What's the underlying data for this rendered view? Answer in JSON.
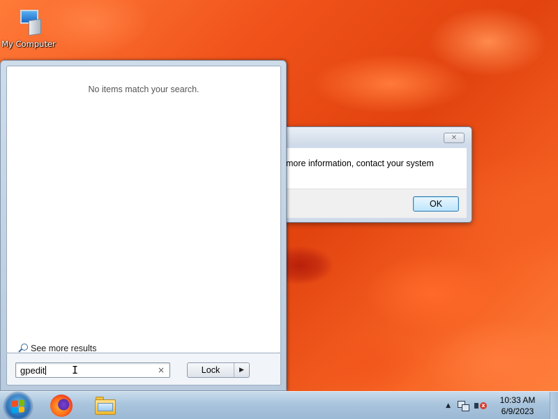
{
  "desktop": {
    "icons": [
      {
        "label": "My Computer",
        "icon": "computer-icon"
      }
    ]
  },
  "dialog": {
    "message": "more information, contact your system",
    "ok_label": "OK",
    "close_glyph": "✕"
  },
  "start_menu": {
    "no_results_text": "No items match your search.",
    "see_more_label": "See more results",
    "search": {
      "value": "gpedit",
      "clear_glyph": "×"
    },
    "power_button": {
      "label": "Lock",
      "arrow_glyph": "▶"
    }
  },
  "taskbar": {
    "apps": [
      {
        "name": "Firefox",
        "icon": "firefox-icon"
      },
      {
        "name": "Windows Explorer",
        "icon": "folder-icon"
      }
    ],
    "tray": {
      "chevron_glyph": "▲",
      "volume_mute_glyph": "x"
    },
    "clock": {
      "time": "10:33 AM",
      "date": "6/9/2023"
    }
  },
  "colors": {
    "accent": "#3c7fb1",
    "wallpaper": "#f0521a",
    "taskbar": "#a9c4dd"
  }
}
